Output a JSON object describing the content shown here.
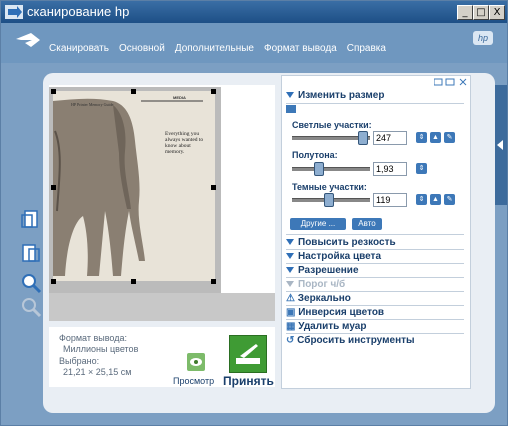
{
  "window": {
    "title": "сканирование hp",
    "min_glyph": "_",
    "max_glyph": "□",
    "close_glyph": "X"
  },
  "menu": [
    {
      "label": "Сканировать"
    },
    {
      "label": "Основной"
    },
    {
      "label": "Дополнительные"
    },
    {
      "label": "Формат вывода"
    },
    {
      "label": "Справка"
    }
  ],
  "brand": {
    "logo_text": "hp"
  },
  "info": {
    "format_label": "Формат вывода:",
    "format_value": "Миллионы цветов",
    "selected_label": "Выбрано:",
    "selected_value": "21,21 × 25,15 см"
  },
  "actions": {
    "preview_label": "Просмотр",
    "accept_label": "Принять"
  },
  "panel": {
    "resize_header": "Изменить размер",
    "highlights_label": "Светлые участки:",
    "highlights_value": "247",
    "midtones_label": "Полутона:",
    "midtones_value": "1,93",
    "shadows_label": "Темные участки:",
    "shadows_value": "119",
    "other_button": "Другие ...",
    "auto_button": "Авто",
    "sharpen_header": "Повысить резкость",
    "color_header": "Настройка цвета",
    "resolution_header": "Разрешение",
    "threshold_header": "Порог ч/б",
    "mirror_label": "Зеркально",
    "invert_label": "Инверсия цветов",
    "moire_label": "Удалить муар",
    "reset_label": "Сбросить инструменты"
  },
  "document": {
    "header_left": "HP Printer Memory Guide",
    "header_right": "MEDIA",
    "quote": "Everything you always wanted to know about memory."
  },
  "colors": {
    "accent": "#3d78b8",
    "window_bg": "#7c9fc3",
    "title_bar": "#1d4f86"
  }
}
